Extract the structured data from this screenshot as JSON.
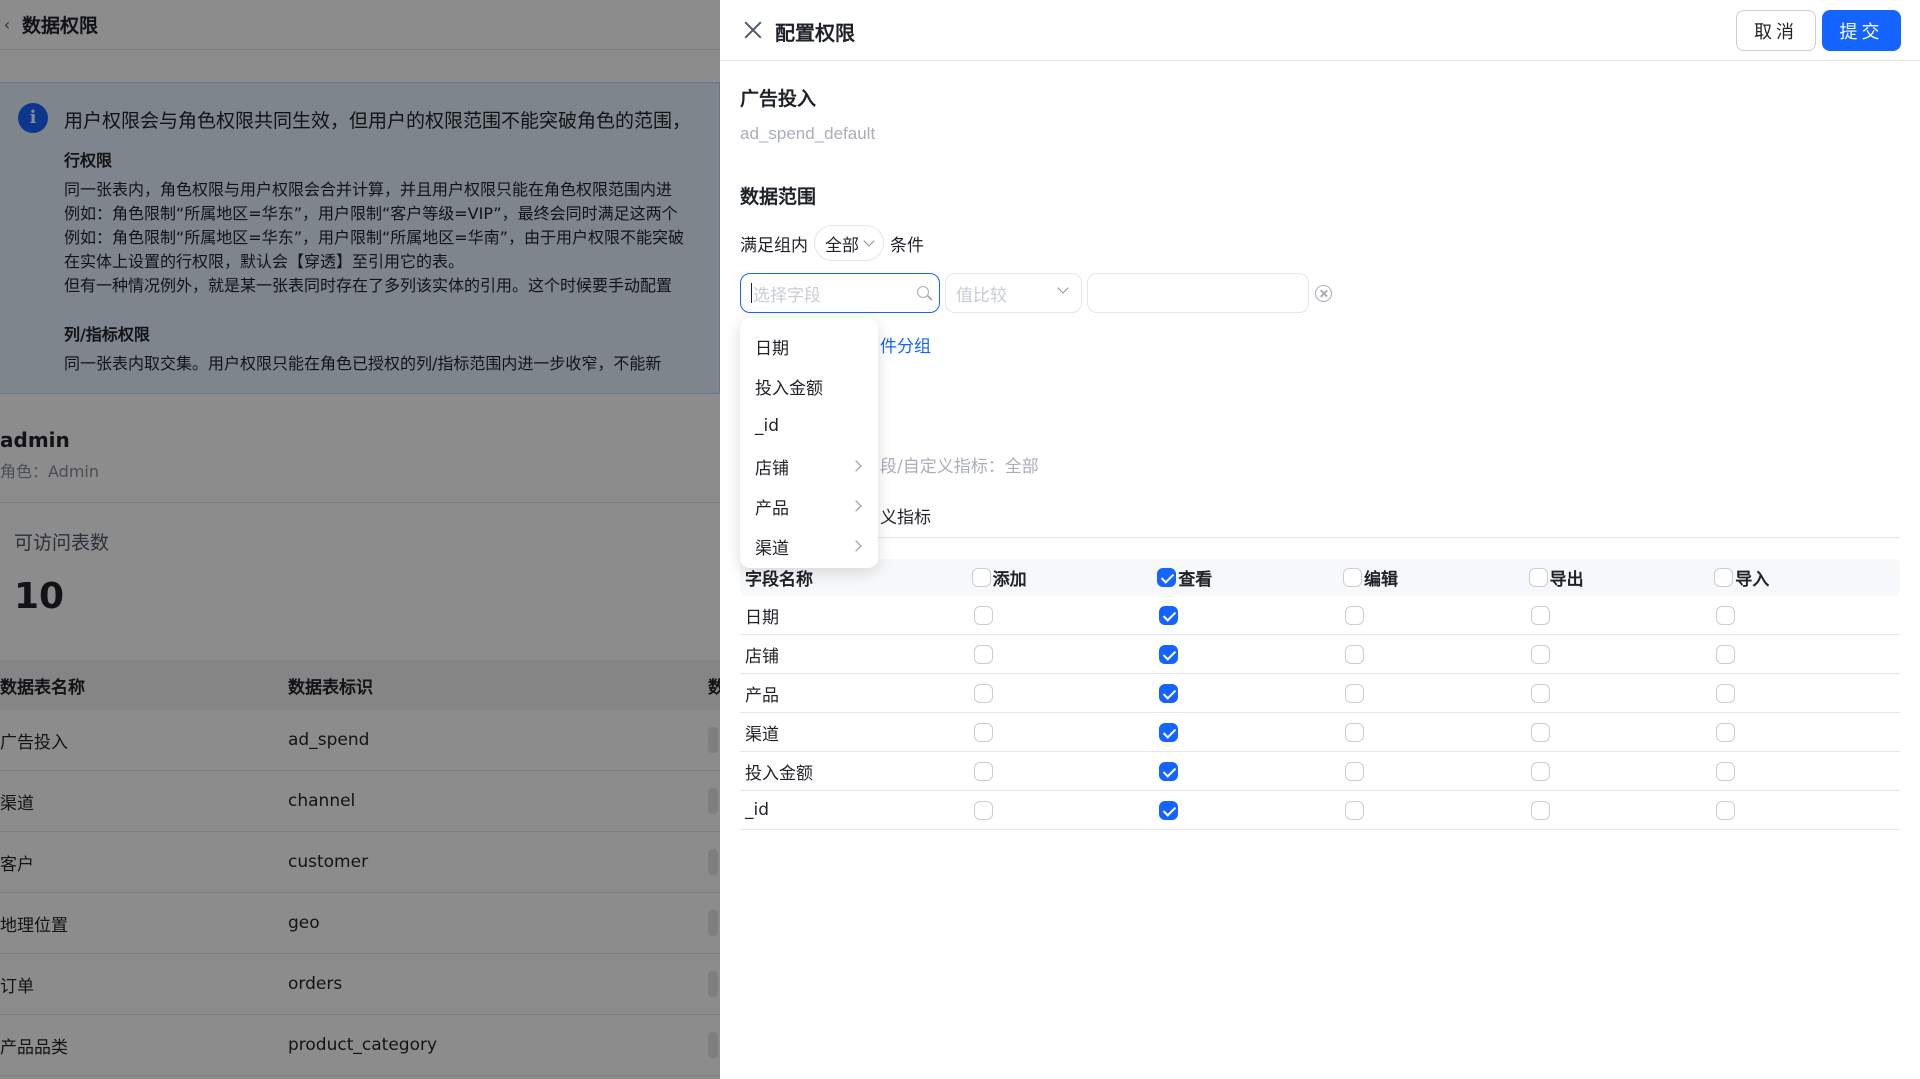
{
  "background": {
    "page_title": "数据权限",
    "info": {
      "main": "用户权限会与角色权限共同生效，但用户的权限范围不能突破角色的范围，",
      "row_heading": "行权限",
      "row_lines": [
        "同一张表内，角色权限与用户权限会合并计算，并且用户权限只能在角色权限范围内进",
        "例如：角色限制“所属地区=华东”，用户限制“客户等级=VIP”，最终会同时满足这两个",
        "例如：角色限制“所属地区=华东”，用户限制“所属地区=华南”，由于用户权限不能突破",
        "在实体上设置的行权限，默认会【穿透】至引用它的表。",
        "但有一种情况例外，就是某一张表同时存在了多列该实体的引用。这个时候要手动配置"
      ],
      "col_heading": "列/指标权限",
      "col_lines": [
        "同一张表内取交集。用户权限只能在角色已授权的列/指标范围内进一步收窄，不能新"
      ]
    },
    "user_name": "admin",
    "user_role": "角色：Admin",
    "count_label": "可访问表数",
    "count_value": "10",
    "table_headers": [
      "数据表名称",
      "数据表标识",
      "数"
    ],
    "table_rows": [
      {
        "name": "广告投入",
        "ident": "ad_spend"
      },
      {
        "name": "渠道",
        "ident": "channel"
      },
      {
        "name": "客户",
        "ident": "customer"
      },
      {
        "name": "地理位置",
        "ident": "geo"
      },
      {
        "name": "订单",
        "ident": "orders"
      },
      {
        "name": "产品品类",
        "ident": "product_category"
      }
    ]
  },
  "drawer": {
    "title": "配置权限",
    "cancel_label": "取消",
    "submit_label": "提交",
    "table_name": "广告投入",
    "table_ident": "ad_spend_default",
    "data_scope_title": "数据范围",
    "cond_prefix": "满足组内",
    "cond_mode": "全部",
    "cond_suffix": "条件",
    "field_placeholder": "选择字段",
    "compare_placeholder": "值比较",
    "add_group_link": "件分组",
    "fields_summary": "段/自定义指标：全部",
    "custom_metric_tab": "义指标",
    "dropdown_items": [
      {
        "label": "日期",
        "has_children": false
      },
      {
        "label": "投入金额",
        "has_children": false
      },
      {
        "label": "_id",
        "has_children": false
      },
      {
        "label": "店铺",
        "has_children": true
      },
      {
        "label": "产品",
        "has_children": true
      },
      {
        "label": "渠道",
        "has_children": true
      }
    ],
    "perm_columns": [
      "字段名称",
      "添加",
      "查看",
      "编辑",
      "导出",
      "导入"
    ],
    "perm_header_checked": [
      false,
      true,
      false,
      false,
      false
    ],
    "perm_rows": [
      {
        "field": "日期",
        "perms": [
          false,
          true,
          false,
          false,
          false
        ]
      },
      {
        "field": "店铺",
        "perms": [
          false,
          true,
          false,
          false,
          false
        ]
      },
      {
        "field": "产品",
        "perms": [
          false,
          true,
          false,
          false,
          false
        ]
      },
      {
        "field": "渠道",
        "perms": [
          false,
          true,
          false,
          false,
          false
        ]
      },
      {
        "field": "投入金额",
        "perms": [
          false,
          true,
          false,
          false,
          false
        ]
      },
      {
        "field": "_id",
        "perms": [
          false,
          true,
          false,
          false,
          false
        ]
      }
    ]
  },
  "colors": {
    "primary": "#1664ff",
    "overlay": "rgba(0,0,0,0.45)",
    "info_bg": "#e8f3ff"
  }
}
